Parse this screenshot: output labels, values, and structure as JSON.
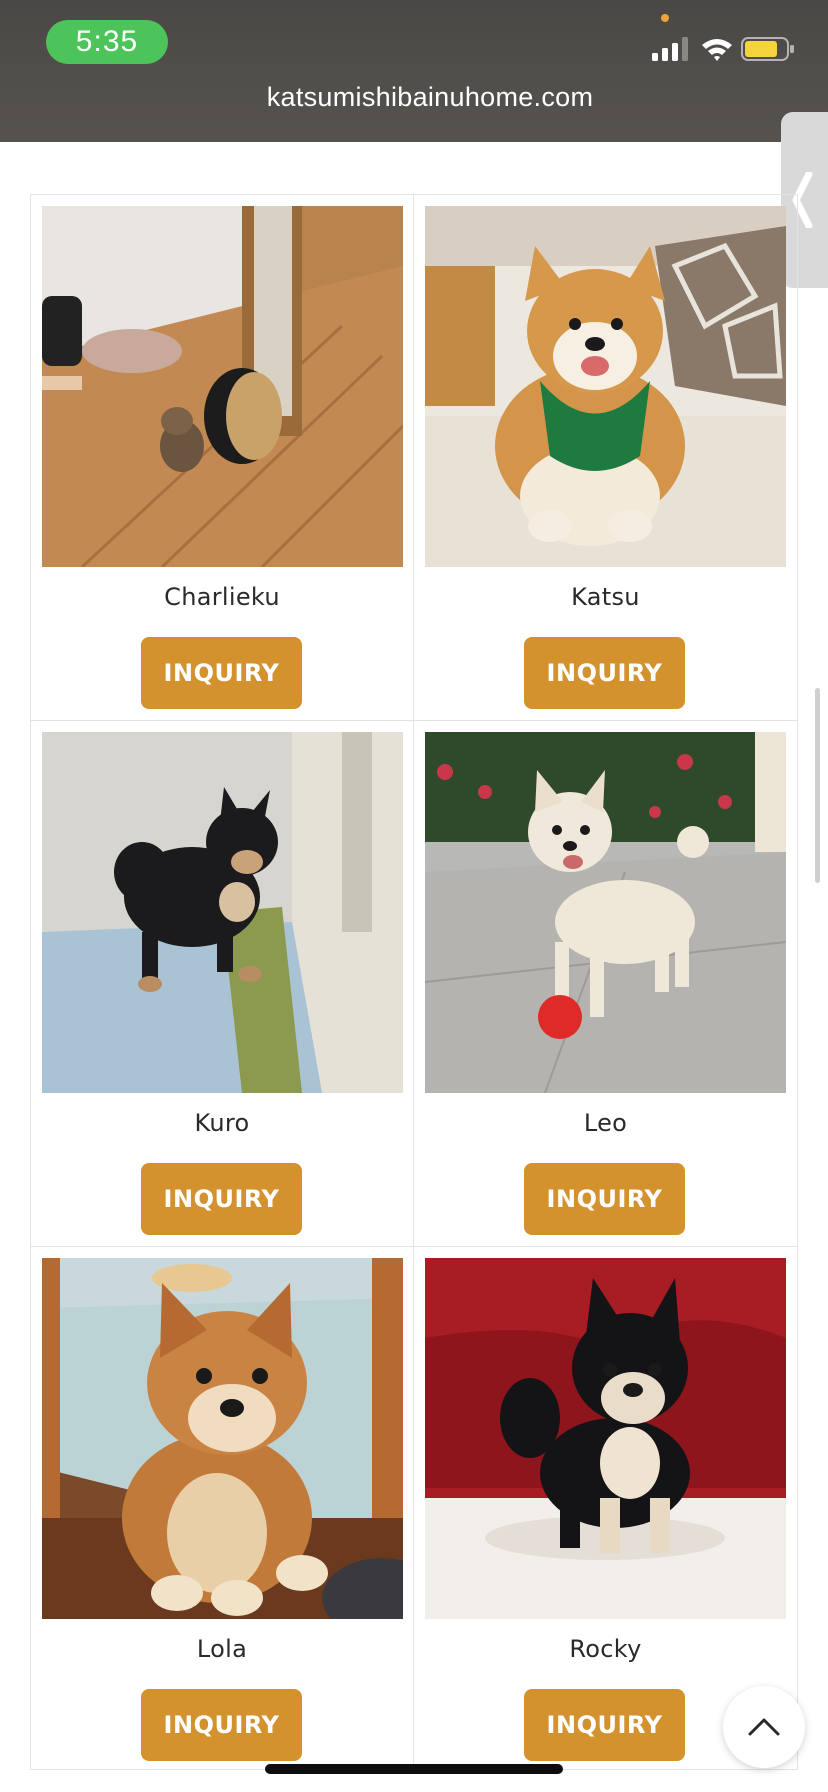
{
  "status_bar": {
    "time": "5:35",
    "signal_icon": "cellular-signal-icon",
    "wifi_icon": "wifi-icon",
    "battery_icon": "battery-icon",
    "battery_color": "#f5d33c",
    "time_pill_color": "#4cc45a"
  },
  "browser": {
    "url": "katsumishibainuhome.com"
  },
  "side_tab": {
    "icon": "chevron-left-icon"
  },
  "accent_color": "#d4922f",
  "puppies": [
    {
      "name": "Charlieku",
      "button_label": "INQUIRY"
    },
    {
      "name": "Katsu",
      "button_label": "INQUIRY"
    },
    {
      "name": "Kuro",
      "button_label": "INQUIRY"
    },
    {
      "name": "Leo",
      "button_label": "INQUIRY"
    },
    {
      "name": "Lola",
      "button_label": "INQUIRY"
    },
    {
      "name": "Rocky",
      "button_label": "INQUIRY"
    }
  ],
  "back_to_top": {
    "icon": "chevron-up-icon"
  }
}
